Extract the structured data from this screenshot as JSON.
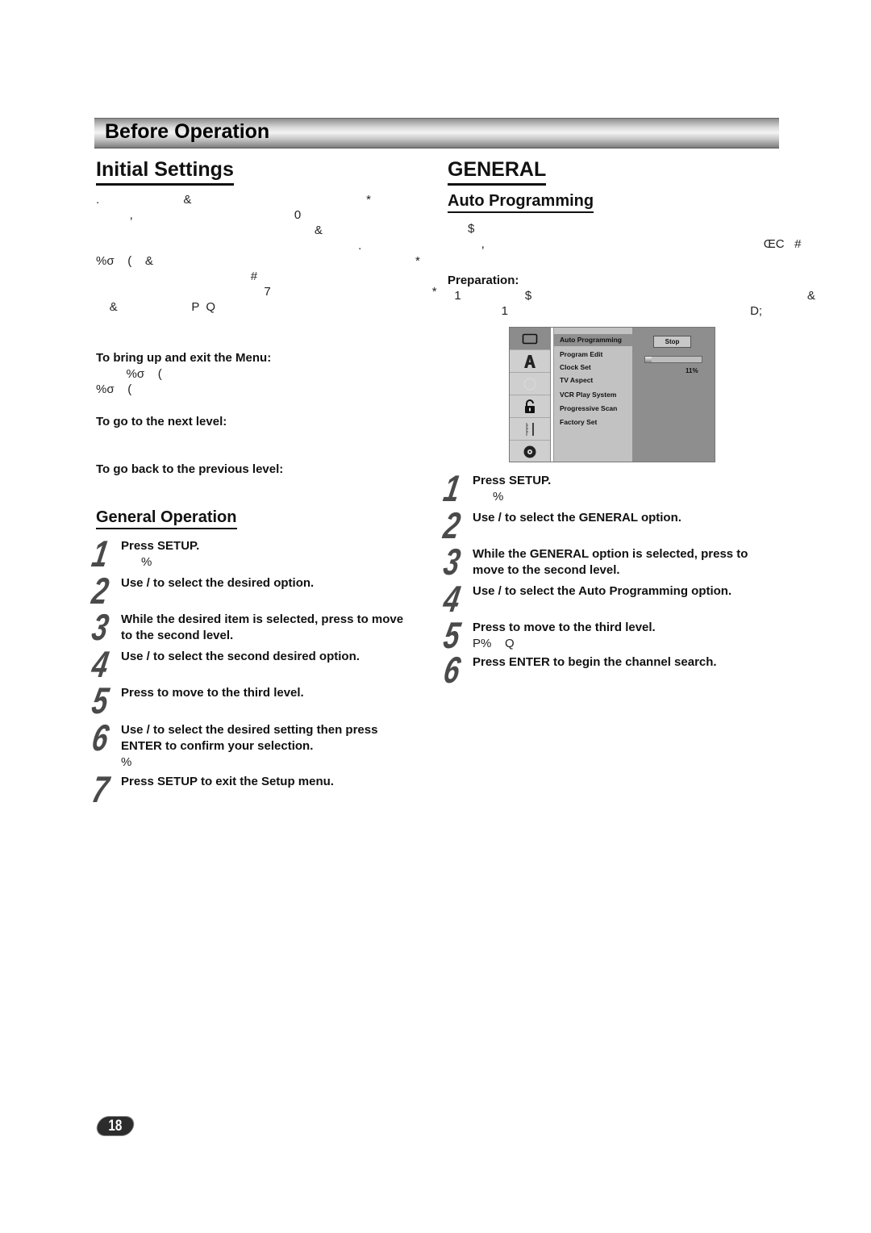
{
  "header": {
    "section_title": "Before Operation"
  },
  "left": {
    "title": "Initial Settings",
    "intro_glyph_lines": [
      ".                         &                                                    *",
      "          ,                                                0",
      "                                                                 &",
      "                                                                              .",
      "%σ    (    &                                                                              *",
      "                                              #",
      "                                                  7                                                *",
      "    &                      P  Q"
    ],
    "menu_help": {
      "bring_up_label": "To bring up and exit the Menu:",
      "bring_up_lines": [
        "         %σ    (",
        "%σ    ("
      ],
      "next_level_label": "To go to the next level:",
      "prev_level_label": "To go back to the previous level:"
    },
    "general_operation": {
      "title": "General Operation",
      "steps": [
        {
          "num": "1",
          "text": "Press SETUP.",
          "sub": "      %"
        },
        {
          "num": "2",
          "text": "Use    /    to select the desired option."
        },
        {
          "num": "3",
          "text": "While the desired item is selected, press     to move to the second level."
        },
        {
          "num": "4",
          "text": "Use    /    to select the second desired option."
        },
        {
          "num": "5",
          "text": "Press     to move to the third level."
        },
        {
          "num": "6",
          "text": "Use    /    to select the desired setting then press ENTER to confirm your selection.",
          "sub": "%"
        },
        {
          "num": "7",
          "text": "Press SETUP to exit the Setup menu."
        }
      ]
    }
  },
  "right": {
    "title": "GENERAL",
    "auto_programming": {
      "title": "Auto Programming",
      "intro_glyph_lines": [
        "      $",
        "          ,                                                                                   ŒC   #"
      ],
      "preparation_label": "Preparation:",
      "preparation_glyph_lines": [
        "  1                   $                                                                                  &",
        "                1                                                                        D;"
      ]
    },
    "osd": {
      "icons": [
        "tv-screen-icon",
        "language-a-icon",
        "circle-icon",
        "padlock-icon",
        "ruler-icon",
        "disc-icon"
      ],
      "menu_items": [
        "Auto Programming",
        "Program Edit",
        "Clock Set",
        "TV Aspect",
        "VCR Play System",
        "Progressive Scan",
        "Factory Set"
      ],
      "selected_item": "Auto Programming",
      "stop_button": "Stop",
      "progress_fraction": 0.11,
      "progress_label": "11%"
    },
    "steps": [
      {
        "num": "1",
        "text": "Press SETUP.",
        "sub": "      %"
      },
      {
        "num": "2",
        "text": "Use    /    to select the GENERAL option."
      },
      {
        "num": "3",
        "text": "While the GENERAL option is selected, press to move to the second level."
      },
      {
        "num": "4",
        "text": "Use    /    to select the Auto Programming option."
      },
      {
        "num": "5",
        "text": "Press     to move to the third level.",
        "sub": "P%    Q"
      },
      {
        "num": "6",
        "text": "Press ENTER to begin the channel search."
      }
    ]
  },
  "footer": {
    "page_number": "18"
  }
}
